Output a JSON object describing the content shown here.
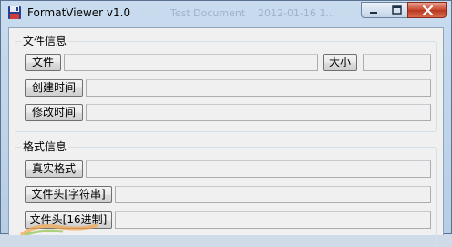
{
  "window": {
    "title": "FormatViewer v1.0",
    "background_title_a": "Test Document",
    "background_title_b": "2012-01-16 1..."
  },
  "file_info": {
    "group_label": "文件信息",
    "file_button": "文件",
    "file_value": "",
    "size_button": "大小",
    "size_value": "",
    "created_button": "创建时间",
    "created_value": "",
    "modified_button": "修改时间",
    "modified_value": ""
  },
  "format_info": {
    "group_label": "格式信息",
    "real_format_button": "真实格式",
    "real_format_value": "",
    "header_string_button": "文件头[字符串]",
    "header_string_value": "",
    "header_hex_button": "文件头[16进制]",
    "header_hex_value": ""
  },
  "colors": {
    "titlebar": "#c9dcef",
    "client_bg": "#f0f0f0",
    "close_button": "#c8452c"
  }
}
